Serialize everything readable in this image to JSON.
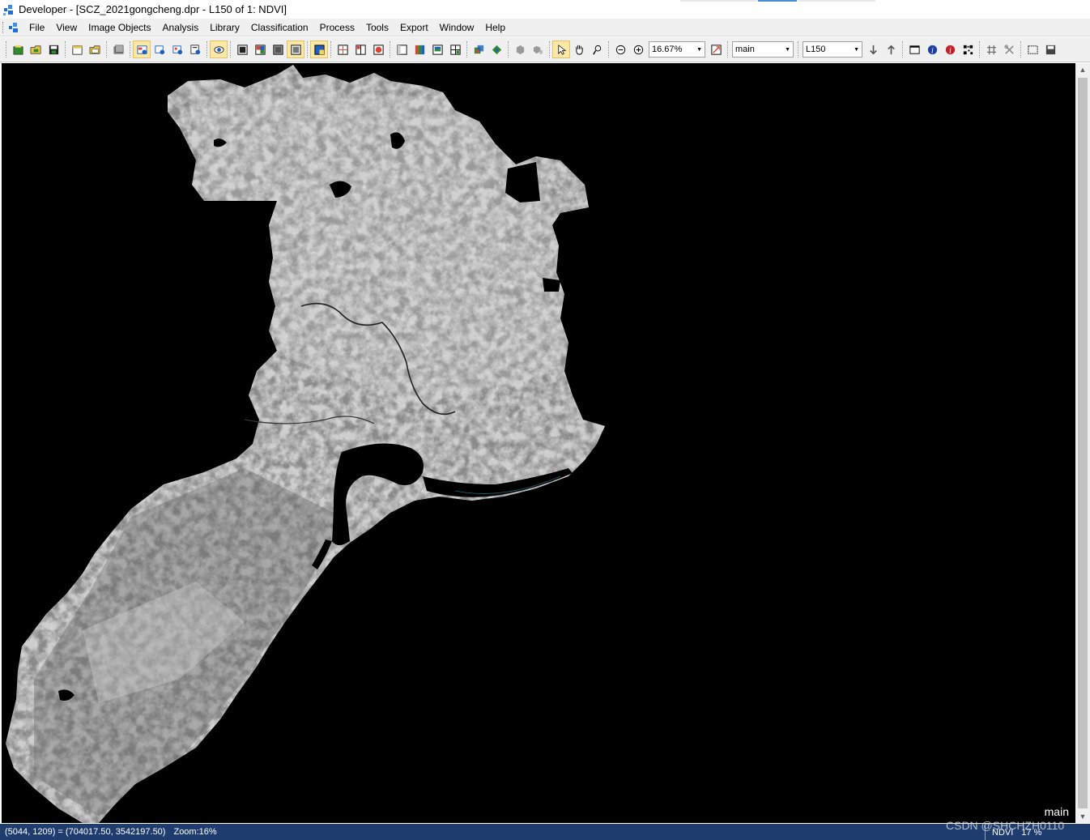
{
  "window": {
    "title": "Developer - [SCZ_2021gongcheng.dpr - L150 of 1: NDVI]"
  },
  "menu": {
    "items": [
      "File",
      "View",
      "Image Objects",
      "Analysis",
      "Library",
      "Classification",
      "Process",
      "Tools",
      "Export",
      "Window",
      "Help"
    ]
  },
  "toolbar": {
    "zoom_value": "16.67%",
    "map_select": "main",
    "level_select": "L150"
  },
  "viewer": {
    "map_label": "main"
  },
  "status": {
    "coords": "(5044, 1209) = (704017.50, 3542197.50)",
    "zoom": "Zoom:16%",
    "layer": "NDVI",
    "value": "17 %"
  },
  "watermark": "CSDN @SHCHZH0110",
  "colors": {
    "title_bg": "#ffffff",
    "chrome_bg": "#f0f0f0",
    "canvas_bg": "#000000",
    "status_bg": "#1e3c6e",
    "active_tool": "#fbe8a6"
  },
  "icons": {
    "toolbar_group1": [
      "new-project-icon",
      "open-project-icon",
      "save-project-icon"
    ],
    "toolbar_group2": [
      "new-workspace-icon",
      "open-workspace-icon"
    ],
    "toolbar_group3": [
      "layer-view-icon"
    ],
    "toolbar_group4": [
      "view-1-icon",
      "view-2-icon",
      "view-3-icon",
      "view-4-icon"
    ],
    "toolbar_group5": [
      "image-view-icon"
    ],
    "toolbar_group6": [
      "layer-mix-1-icon",
      "layer-mix-2-icon",
      "layer-mix-3-icon",
      "layer-mix-4-icon"
    ],
    "toolbar_group7": [
      "split-view-icon"
    ],
    "toolbar_group8": [
      "single-view-icon",
      "rgb-view-icon",
      "hsi-view-icon",
      "grid-view-icon"
    ],
    "toolbar_group9": [
      "object-outline-icon",
      "classify-icon"
    ],
    "toolbar_group10": [
      "polygon-icon",
      "polygon-fill-icon"
    ],
    "toolbar_group11": [
      "select-cursor-icon",
      "pan-hand-icon",
      "zoom-tool-icon"
    ],
    "toolbar_group12": [
      "zoom-out-icon",
      "zoom-in-icon"
    ],
    "toolbar_group13": [
      "fit-window-icon"
    ],
    "toolbar_group14": [
      "level-down-icon",
      "level-up-icon"
    ],
    "toolbar_group15": [
      "window-icon",
      "info-icon",
      "feature-info-icon",
      "qr-icon"
    ],
    "toolbar_group16": [
      "grid-icon",
      "tools-icon"
    ],
    "toolbar_group17": [
      "select-rect-icon",
      "save-view-icon"
    ]
  }
}
